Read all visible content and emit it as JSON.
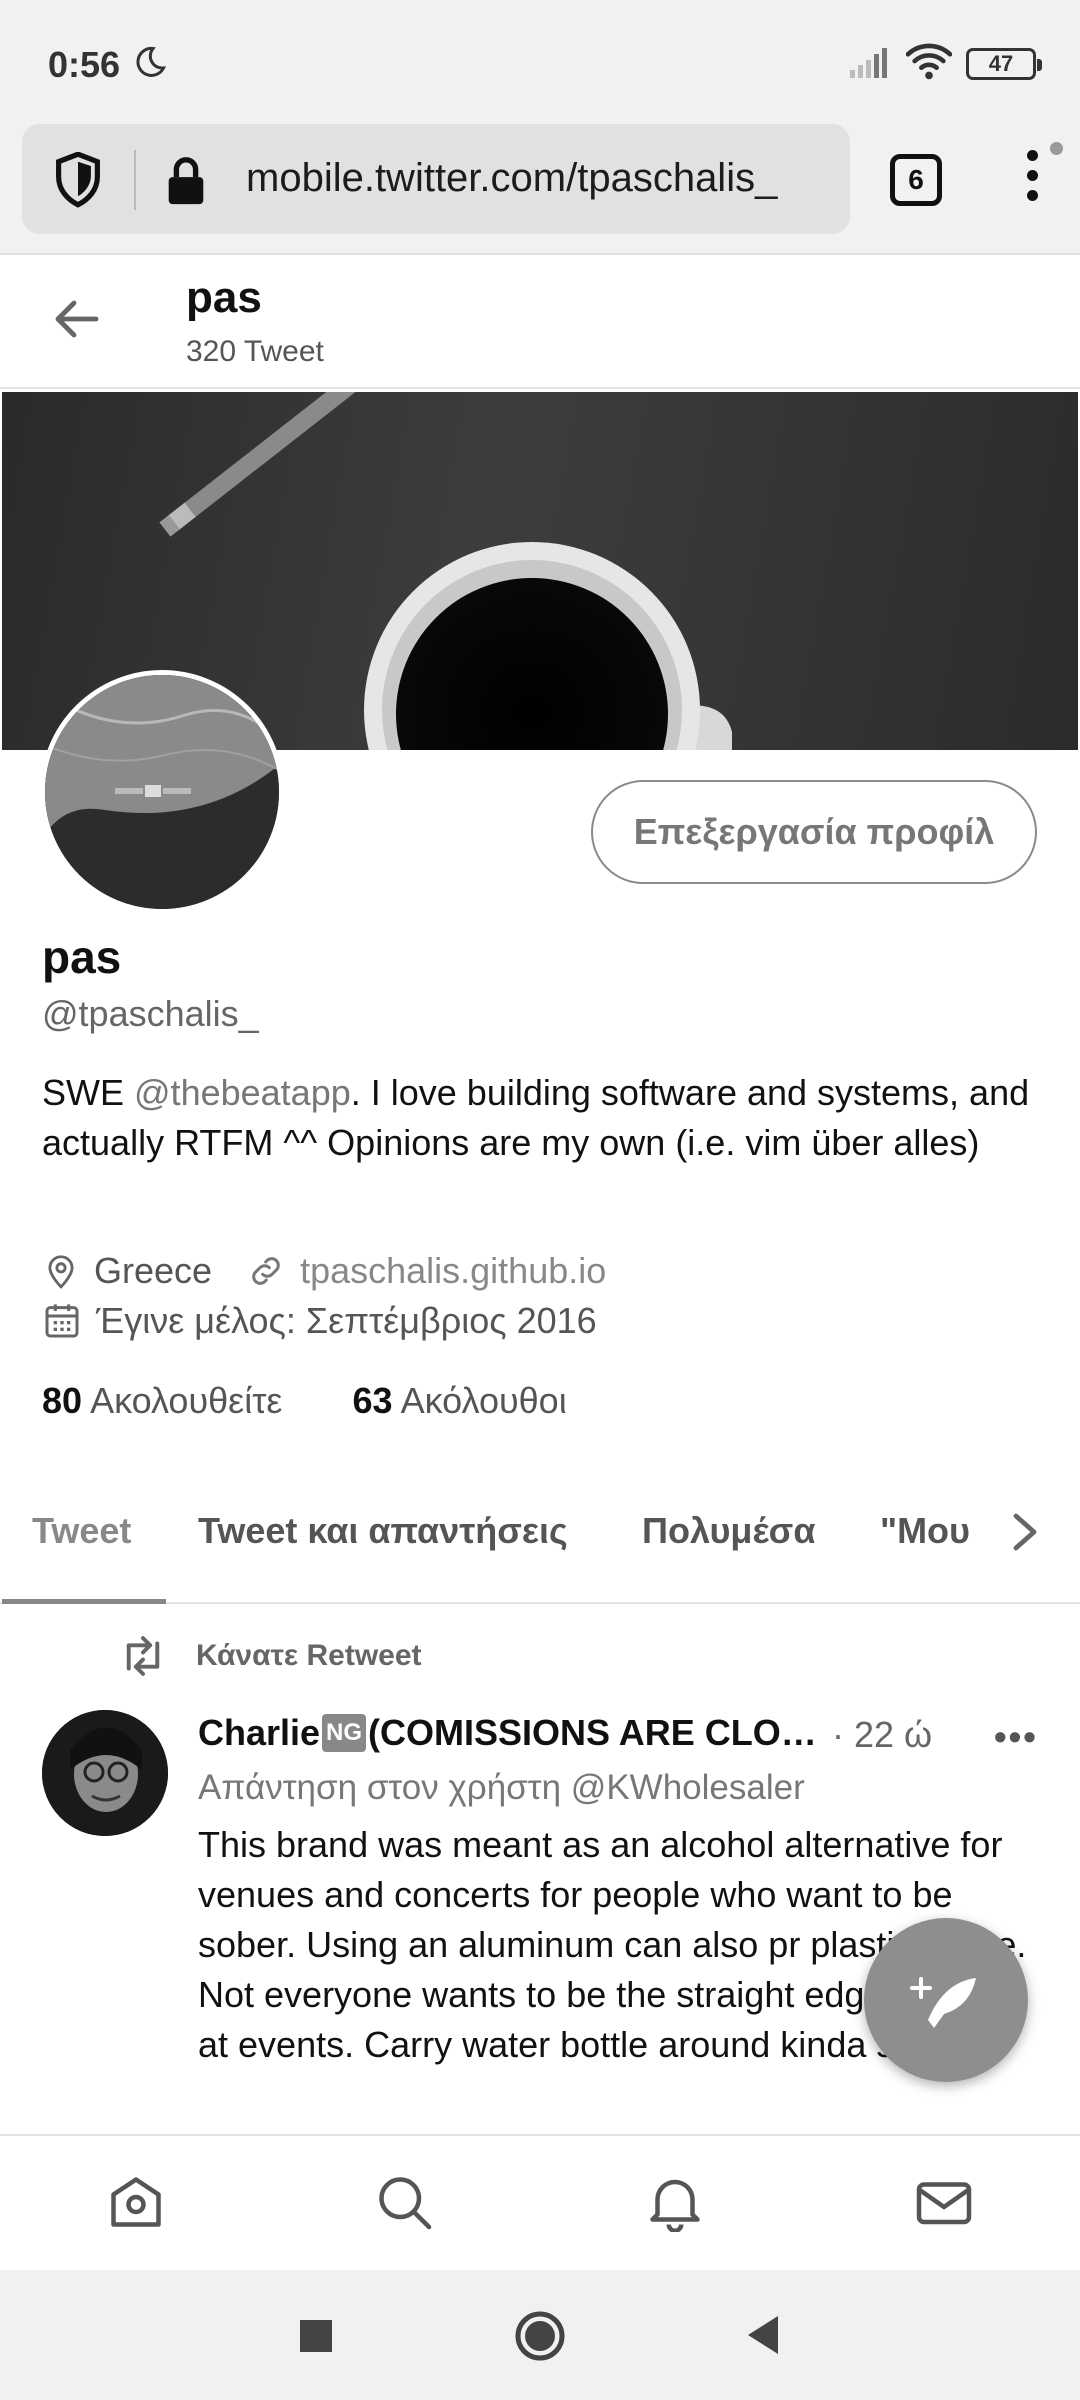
{
  "status_bar": {
    "time": "0:56",
    "battery": "47",
    "icons": [
      "moon-icon",
      "signal-icon",
      "wifi-icon",
      "battery-icon"
    ]
  },
  "browser": {
    "url": "mobile.twitter.com/tpaschalis_",
    "tab_count": "6"
  },
  "header": {
    "name": "pas",
    "tweet_count": "320 Tweet"
  },
  "profile": {
    "edit_button": "Επεξεργασία προφίλ",
    "name": "pas",
    "handle": "@tpaschalis_",
    "bio_prefix": "SWE ",
    "bio_mention": "@thebeatapp",
    "bio_suffix": ". I love building software and systems, and actually RTFM ^^ Opinions are my own (i.e. vim über alles)",
    "location": "Greece",
    "website": "tpaschalis.github.io",
    "joined": "Έγινε μέλος: Σεπτέμβριος 2016",
    "following_count": "80",
    "following_label": "Ακολουθείτε",
    "followers_count": "63",
    "followers_label": "Ακόλουθοι"
  },
  "tabs": [
    {
      "label": "Tweet",
      "active": true
    },
    {
      "label": "Tweet και απαντήσεις",
      "active": false
    },
    {
      "label": "Πολυμέσα",
      "active": false
    },
    {
      "label": "\"Μου",
      "active": false
    }
  ],
  "tweet": {
    "retweet_label": "Κάνατε Retweet",
    "author_prefix": "Charlie",
    "author_badge": "NG",
    "author_suffix": "(COMISSIONS ARE CLO…",
    "time": "· 22 ώ",
    "more": "•••",
    "reply_to": "Απάντηση στον χρήστη @KWholesaler",
    "text": "This brand was meant as an alcohol alternative for venues and concerts for people who want to be sober. Using an aluminum can also pr plastic waste. Not everyone wants to be the straight edge person at events. Carry water bottle around kinda sucks"
  },
  "bottom_nav": [
    "home-icon",
    "search-icon",
    "notifications-icon",
    "messages-icon"
  ],
  "colors": {
    "accent": "#888888",
    "text": "#111111",
    "muted": "#666666"
  }
}
